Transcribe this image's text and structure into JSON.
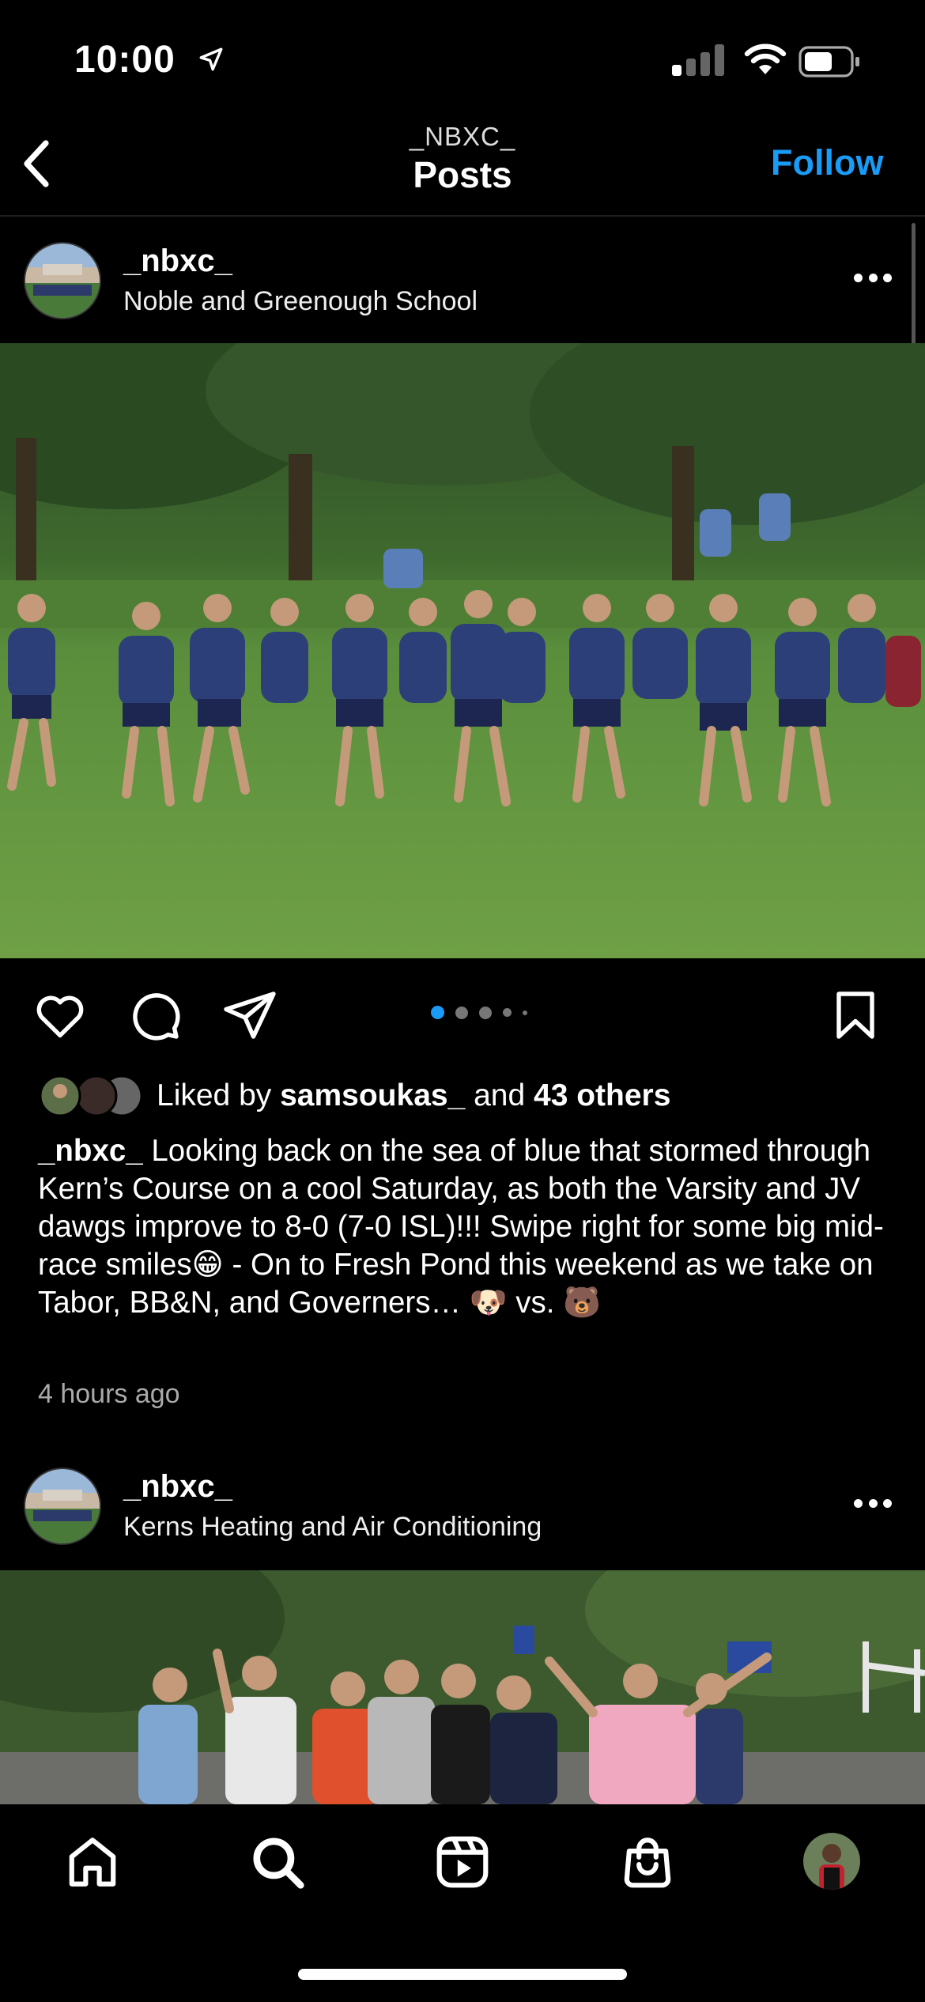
{
  "status_bar": {
    "time": "10:00"
  },
  "nav": {
    "subtitle": "_NBXC_",
    "title": "Posts",
    "follow_label": "Follow"
  },
  "post1": {
    "username": "_nbxc_",
    "location": "Noble and Greenough School",
    "liked_prefix": "Liked by ",
    "liked_user": "samsoukas_",
    "liked_and": " and ",
    "liked_others": "43 others",
    "caption_user": "_nbxc_",
    "caption_text": " Looking back on the sea of blue that stormed through Kern’s Course on a cool Saturday, as both the Varsity and JV dawgs improve to 8-0 (7-0 ISL)!!! Swipe right for some big mid-race smiles😁 - On to Fresh Pond this weekend as we take on Tabor, BB&N, and Governers… 🐶 vs. 🐻",
    "time_ago": "4 hours ago",
    "carousel": {
      "count": 5,
      "active": 1
    }
  },
  "post2": {
    "username": "_nbxc_",
    "location": "Kerns Heating and Air Conditioning"
  },
  "colors": {
    "accent": "#1a9bf5",
    "background": "#000000"
  },
  "icons": [
    "location-arrow-icon",
    "signal-icon",
    "wifi-icon",
    "battery-icon",
    "back-chevron-icon",
    "more-dots-icon",
    "heart-icon",
    "comment-icon",
    "share-icon",
    "bookmark-icon",
    "home-icon",
    "search-icon",
    "reels-icon",
    "shop-icon",
    "profile-avatar"
  ]
}
